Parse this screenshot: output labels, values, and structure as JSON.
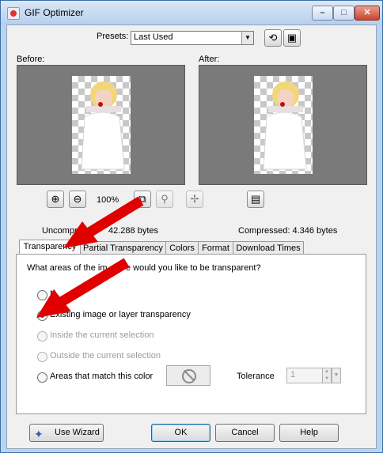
{
  "window": {
    "title": "GIF Optimizer"
  },
  "presets": {
    "label": "Presets:",
    "value": "Last Used"
  },
  "preview": {
    "before_label": "Before:",
    "after_label": "After:",
    "zoom": "100%"
  },
  "sizes": {
    "uncompressed_prefix": "Uncompr",
    "uncompressed_suffix": "42.288 bytes",
    "compressed": "Compressed: 4.346 bytes"
  },
  "tabs": [
    {
      "label": "Transparency"
    },
    {
      "label": "Partial Transparency"
    },
    {
      "label": "Colors"
    },
    {
      "label": "Format"
    },
    {
      "label": "Download Times"
    }
  ],
  "transparency": {
    "question_a": "What areas of the im",
    "question_b": "e would you like to be transparent?",
    "opt_none": "N",
    "opt_existing": "Existing image or layer transparency",
    "opt_inside": "Inside the current selection",
    "opt_outside": "Outside the current selection",
    "opt_color": "Areas that match this color",
    "tolerance_label": "Tolerance",
    "tolerance_value": "1"
  },
  "buttons": {
    "wizard": "Use Wizard",
    "ok": "OK",
    "cancel": "Cancel",
    "help": "Help"
  },
  "colors": {
    "accent_red": "#e00000",
    "title_bar": "#bcd3ee"
  }
}
